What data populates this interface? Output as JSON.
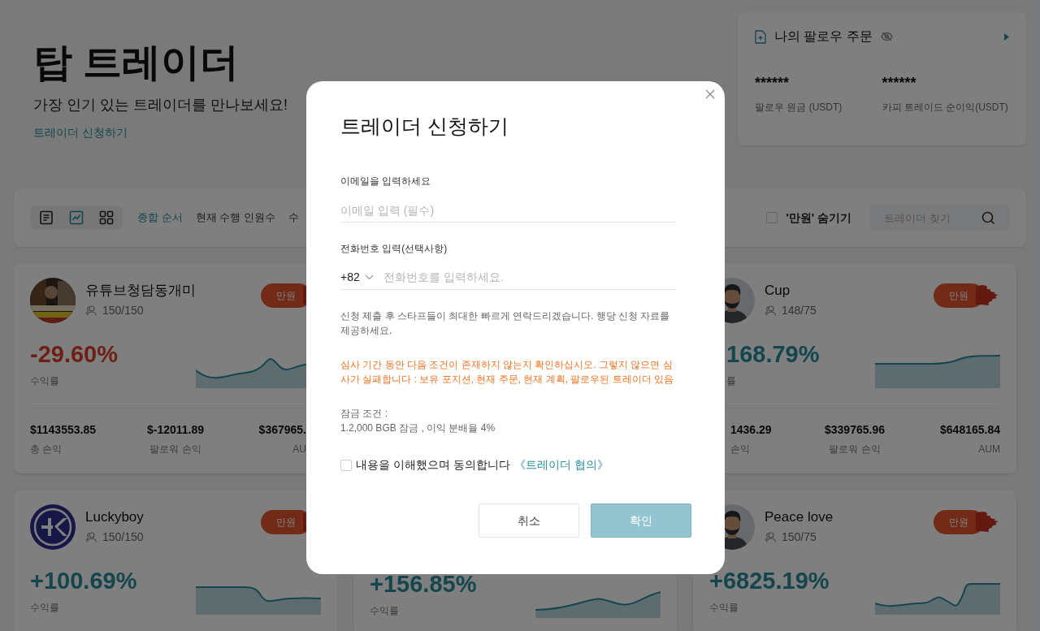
{
  "header": {
    "title": "탑 트레이더",
    "subtitle": "가장 인기 있는 트레이더를 만나보세요!",
    "apply_link": "트레이더 신청하기"
  },
  "my_orders": {
    "title": "나의 팔로우 주문",
    "stats": [
      {
        "value": "******",
        "label": "팔로우 원금 (USDT)"
      },
      {
        "value": "******",
        "label": "카피 트레이드 순이익(USDT)"
      }
    ]
  },
  "filter_bar": {
    "views": [
      {
        "kind": "list",
        "selected": false
      },
      {
        "kind": "chart",
        "selected": true
      },
      {
        "kind": "grid",
        "selected": false
      }
    ],
    "sort_tabs": [
      {
        "label": "종합 순서",
        "selected": true
      },
      {
        "label": "현재 수행 인원수",
        "selected": false
      },
      {
        "label": "수",
        "selected": false
      }
    ],
    "hide_option": {
      "label": "'만원' 숨기기",
      "checked": false
    },
    "search": {
      "placeholder": "트레이더 찾기"
    }
  },
  "cards": [
    {
      "name": "유튜브청담동개미",
      "followers": "150/150",
      "badge": "만원",
      "percent": "-29.60%",
      "negative": true,
      "percent_label": "수익률",
      "stats": [
        {
          "value": "$1143553.85",
          "label": "총 손익"
        },
        {
          "value": "$-12011.89",
          "label": "팔로워 손익"
        },
        {
          "value": "$367965.",
          "label": "AU"
        }
      ]
    },
    {
      "name": "Cup",
      "followers": "148/75",
      "badge": "만원",
      "percent": "168.79%",
      "negative": false,
      "percent_label": "률",
      "stats": [
        {
          "value": "1436.29",
          "label": "손익"
        },
        {
          "value": "$339765.96",
          "label": "팔로워 손익"
        },
        {
          "value": "$648165.84",
          "label": "AUM"
        }
      ]
    },
    {
      "name": "Luckyboy",
      "followers": "150/150",
      "badge": "만원",
      "percent": "+100.69%",
      "negative": false,
      "percent_label": "수익률"
    },
    {
      "percent": "+156.85%",
      "negative": false,
      "percent_label": "수익률"
    },
    {
      "name": "Peace love",
      "followers": "150/75",
      "badge": "만원",
      "percent": "+6825.19%",
      "negative": false,
      "percent_label": "수익률"
    }
  ],
  "dialog": {
    "title": "트레이더 신청하기",
    "email_label": "이메일을 입력하세요",
    "email_placeholder": "이메일 입력 (필수)",
    "phone_label": "전화번호 입력(선택사항)",
    "country_code": "+82",
    "phone_placeholder": "전화번호를 입력하세요.",
    "info": "신청 제출 후 스타프들이 최대한 빠르게 연락드리겠습니다. 행당 신청 자료를 제공하세요.",
    "warning": "심사 기간 동안 다음 조건이 존재하지 않는지 확인하십시오. 그렇지 않으면 심사가 실패합니다 : 보유 포지션, 현재 주문, 현재 계획, 팔로우된 트레이더 있음",
    "lock_title": "잠금 조건 :",
    "lock_terms": "1.2,000 BGB 잠금 , 이익 분배율 4%",
    "agree": {
      "text": "내용을 이해했으며 동의합니다",
      "link": "《트레이더 협의》",
      "checked": false
    },
    "cancel": "취소",
    "confirm": {
      "label": "확인",
      "disabled": true
    }
  }
}
